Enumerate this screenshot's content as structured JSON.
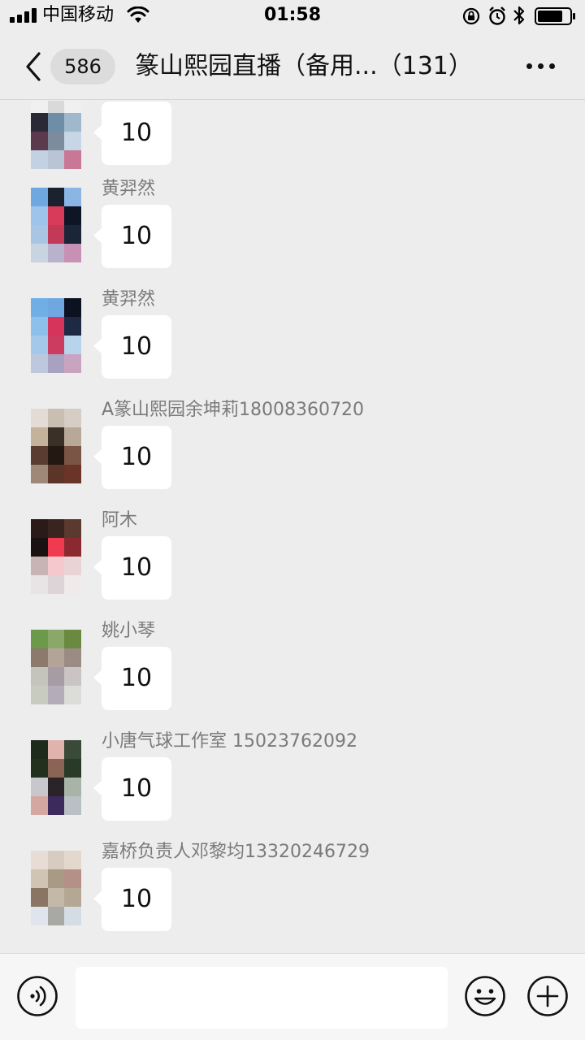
{
  "status_bar": {
    "carrier": "中国移动",
    "time": "01:58"
  },
  "nav": {
    "unread_count": "586",
    "title": "篆山熙园直播（备用...（131）"
  },
  "messages": [
    {
      "sender": "",
      "text": "10",
      "avatar_colors": [
        "#f0f0f0",
        "#d9d9d9",
        "#f0f0f0",
        "#2a2a36",
        "#6e8ea8",
        "#9fb8cc",
        "#5a3a4c",
        "#7c8c9c",
        "#c7d6e6",
        "#c3d2e2",
        "#b9c4d4",
        "#c87896"
      ]
    },
    {
      "sender": "黄羿然",
      "text": "10",
      "avatar_colors": [
        "#6fa8e0",
        "#1a2230",
        "#8ab6e6",
        "#9ec4ec",
        "#d83a5a",
        "#0e1626",
        "#a8c6e4",
        "#c23a58",
        "#1a2638",
        "#c9d4e2",
        "#b8b2cc",
        "#c890b4"
      ]
    },
    {
      "sender": "黄羿然",
      "text": "10",
      "avatar_colors": [
        "#70aee6",
        "#6fa8e0",
        "#0c1220",
        "#8ec0ec",
        "#d6345a",
        "#1e2a44",
        "#a4c8ea",
        "#cc3c60",
        "#b8d4ec",
        "#bcc8dc",
        "#a8a2c0",
        "#c8a4c0"
      ]
    },
    {
      "sender": "A篆山熙园余坤莉18008360720",
      "text": "10",
      "avatar_colors": [
        "#e4dcd4",
        "#c8beb2",
        "#d6cec4",
        "#c4b29c",
        "#3a3028",
        "#b8a898",
        "#5a3c30",
        "#241812",
        "#7a5444",
        "#a08878",
        "#5c3428",
        "#6a3428"
      ]
    },
    {
      "sender": "阿木",
      "text": "10",
      "avatar_colors": [
        "#2a1a18",
        "#3a2420",
        "#5a3a30",
        "#1a1212",
        "#f03a50",
        "#8a2a30",
        "#c8b4b4",
        "#f4c8cc",
        "#e8d4d4",
        "#e8e4e6",
        "#dcd4d6",
        "#f0eaea"
      ]
    },
    {
      "sender": "姚小琴",
      "text": "10",
      "avatar_colors": [
        "#6a9a4a",
        "#8aa86a",
        "#6a8a40",
        "#8c7a6c",
        "#b4a498",
        "#9a8c84",
        "#c4c4bc",
        "#a89ca4",
        "#cac4c4",
        "#c8ccc0",
        "#b4acb8",
        "#dcdcd8"
      ]
    },
    {
      "sender": "小唐气球工作室 15023762092",
      "text": "10",
      "avatar_colors": [
        "#1e2a1c",
        "#e0b4ac",
        "#3a4a38",
        "#24301e",
        "#8a6454",
        "#2a3a28",
        "#c8c8cc",
        "#2a2428",
        "#a8b4a8",
        "#d4a8a0",
        "#3c2a5c",
        "#b8c0c4"
      ]
    },
    {
      "sender": "嘉桥负责人邓黎均13320246729",
      "text": "10",
      "avatar_colors": [
        "#e8ddd4",
        "#d8ccc0",
        "#e4d8cc",
        "#d0c4b4",
        "#a89a84",
        "#b49088",
        "#8a7464",
        "#c4b8a8",
        "#b4a894",
        "#e0e4ec",
        "#a8a8a4",
        "#d4dce4"
      ]
    }
  ],
  "input": {
    "placeholder": ""
  },
  "icons": {
    "back": "chevron-left-icon",
    "more": "more-dots-icon",
    "voice": "voice-icon",
    "emoji": "emoji-icon",
    "plus": "plus-icon"
  }
}
